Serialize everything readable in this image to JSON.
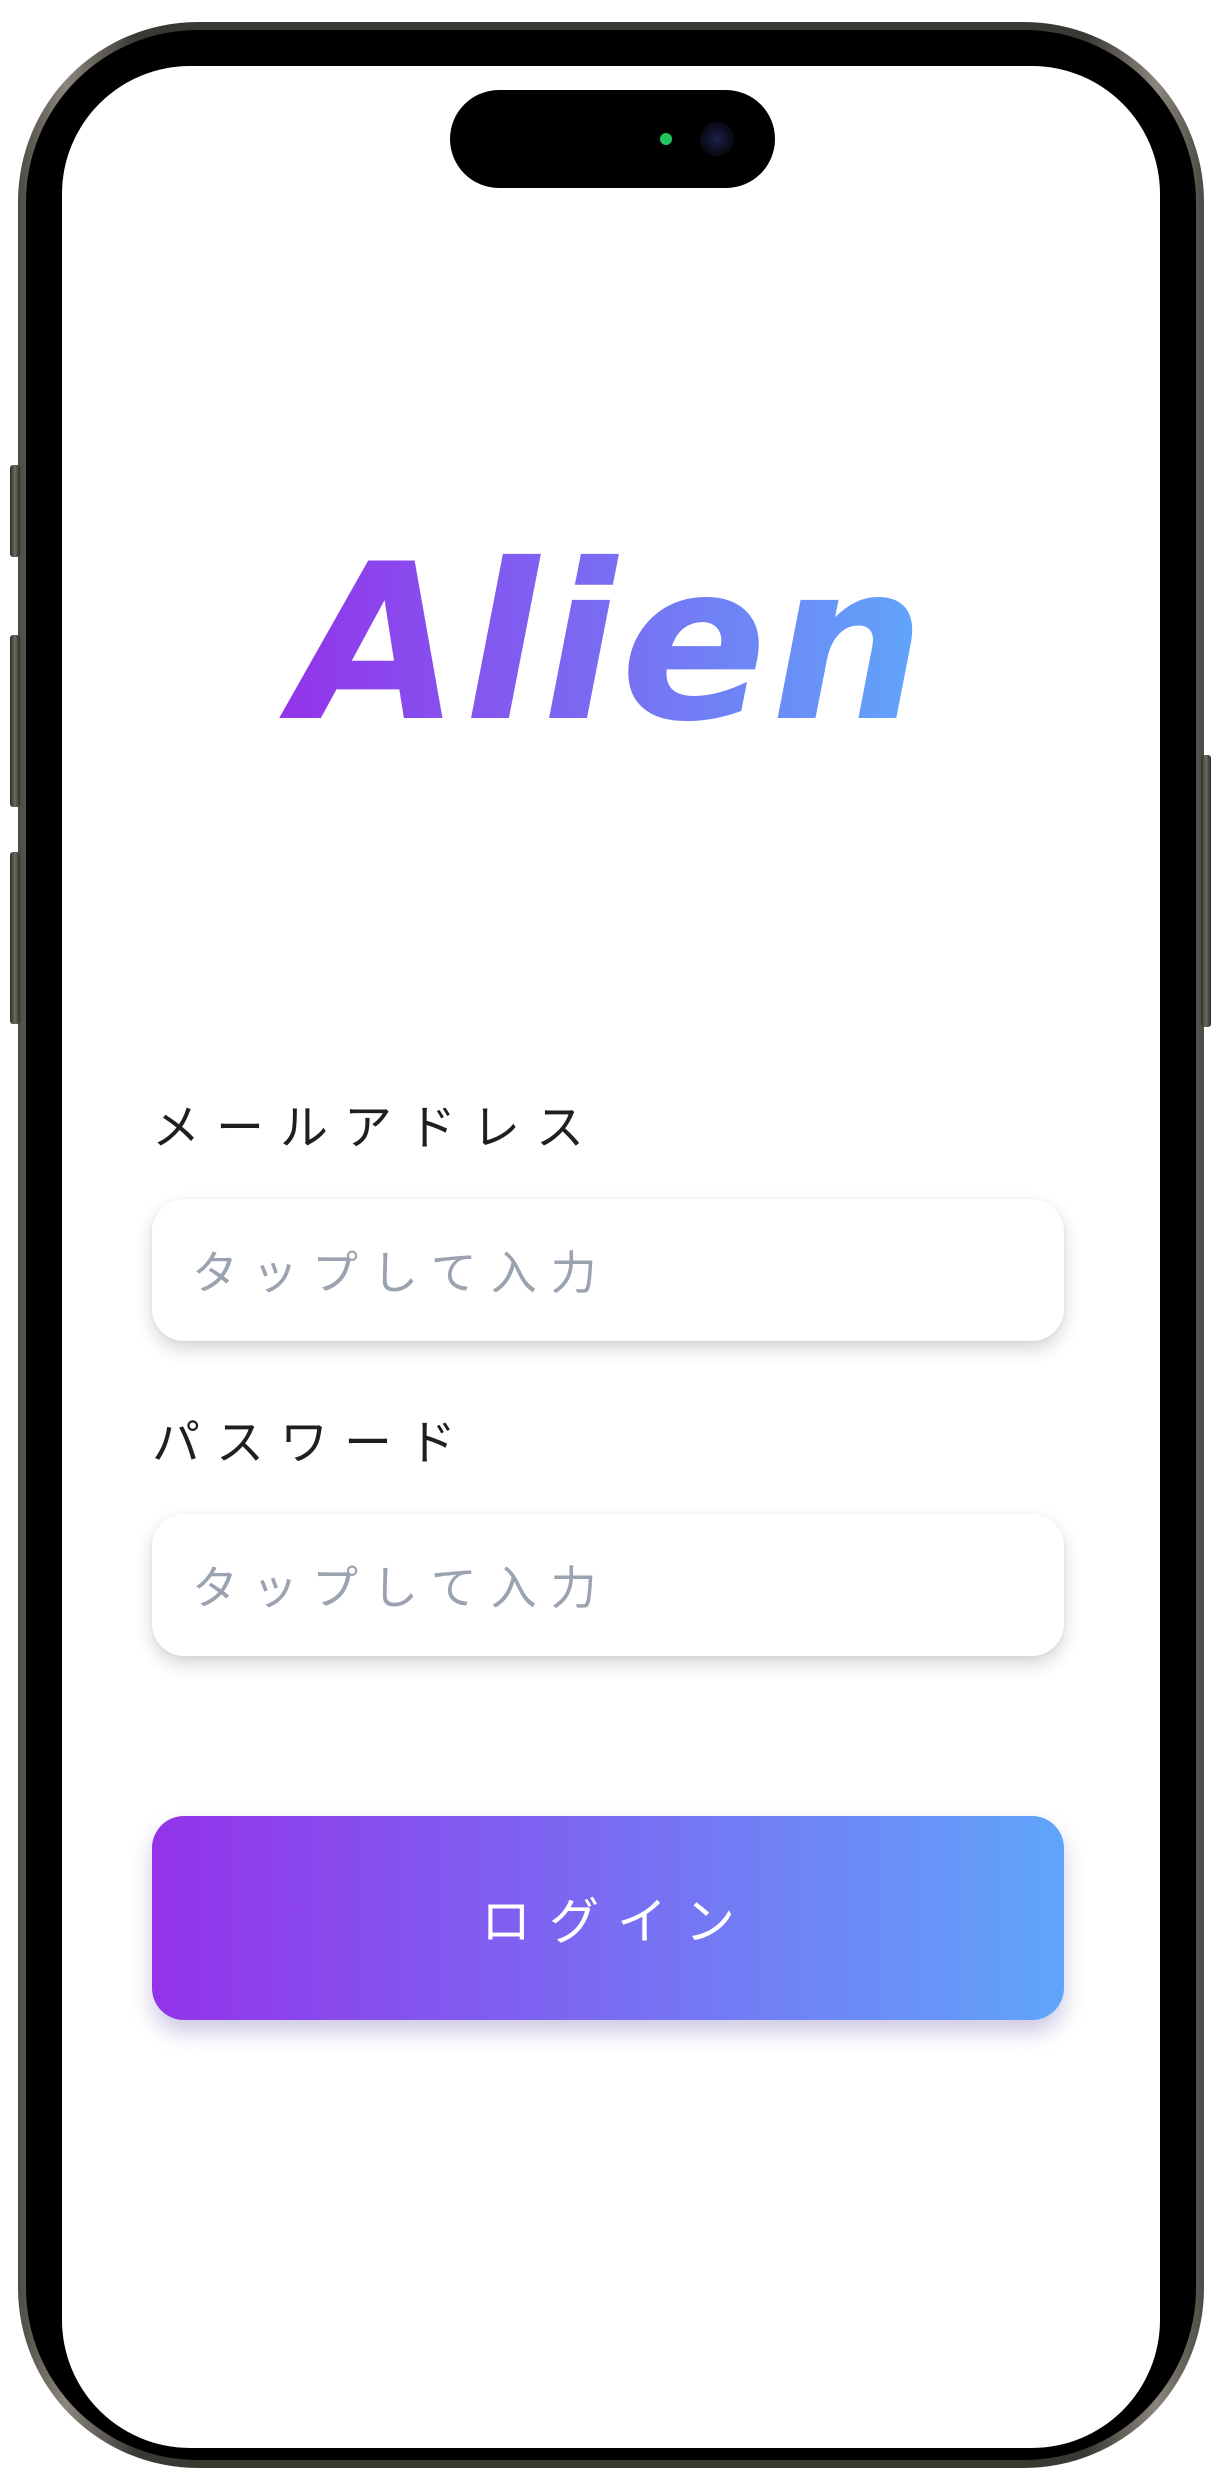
{
  "app": {
    "logo_text": "Alien"
  },
  "form": {
    "email_label": "メールアドレス",
    "email_placeholder": "タップして入力",
    "password_label": "パスワード",
    "password_placeholder": "タップして入力"
  },
  "actions": {
    "login_label": "ログイン"
  },
  "colors": {
    "gradient_start": "#9333ea",
    "gradient_end": "#60a5fa"
  }
}
